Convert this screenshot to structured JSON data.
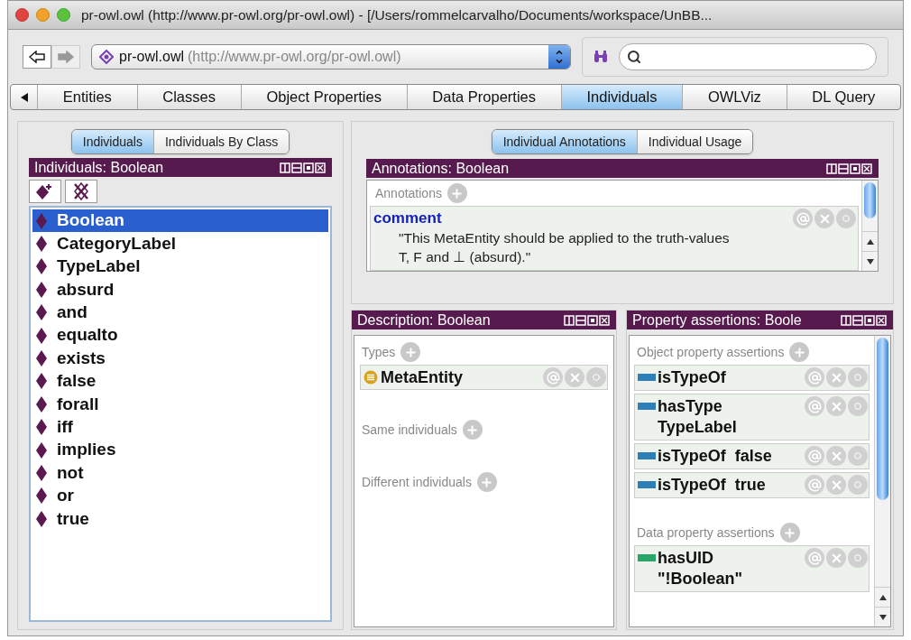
{
  "window": {
    "title": "pr-owl.owl (http://www.pr-owl.org/pr-owl.owl) - [/Users/rommelcarvalho/Documents/workspace/UnBB..."
  },
  "toolbar": {
    "back": {
      "disabled": false
    },
    "forward": {
      "disabled": true
    },
    "ontology": {
      "name": "pr-owl.owl",
      "iri": "(http://www.pr-owl.org/pr-owl.owl)"
    }
  },
  "tabs": [
    {
      "label": "Entities",
      "selected": false
    },
    {
      "label": "Classes",
      "selected": false
    },
    {
      "label": "Object Properties",
      "selected": false
    },
    {
      "label": "Data Properties",
      "selected": false
    },
    {
      "label": "Individuals",
      "selected": true
    },
    {
      "label": "OWLViz",
      "selected": false
    },
    {
      "label": "DL Query",
      "selected": false
    }
  ],
  "individuals_view": {
    "subtabs": [
      {
        "label": "Individuals",
        "selected": true
      },
      {
        "label": "Individuals By Class",
        "selected": false
      }
    ],
    "title": "Individuals: Boolean",
    "items": [
      {
        "label": "Boolean",
        "selected": true
      },
      {
        "label": "CategoryLabel",
        "selected": false
      },
      {
        "label": "TypeLabel",
        "selected": false
      },
      {
        "label": "absurd",
        "selected": false
      },
      {
        "label": "and",
        "selected": false
      },
      {
        "label": "equalto",
        "selected": false
      },
      {
        "label": "exists",
        "selected": false
      },
      {
        "label": "false",
        "selected": false
      },
      {
        "label": "forall",
        "selected": false
      },
      {
        "label": "iff",
        "selected": false
      },
      {
        "label": "implies",
        "selected": false
      },
      {
        "label": "not",
        "selected": false
      },
      {
        "label": "or",
        "selected": false
      },
      {
        "label": "true",
        "selected": false
      }
    ]
  },
  "annotations_view": {
    "subtabs": [
      {
        "label": "Individual Annotations",
        "selected": true
      },
      {
        "label": "Individual Usage",
        "selected": false
      }
    ],
    "title": "Annotations: Boolean",
    "section": "Annotations",
    "entries": [
      {
        "property": "comment",
        "value": "\"This MetaEntity should be applied to the truth-values T, F and ⊥ (absurd).\""
      }
    ]
  },
  "description": {
    "title": "Description: Boolean",
    "sections": [
      {
        "label": "Types",
        "items": [
          "MetaEntity"
        ]
      },
      {
        "label": "Same individuals"
      },
      {
        "label": "Different individuals"
      }
    ]
  },
  "property_assertions": {
    "title": "Property assertions: Boole",
    "sections": [
      {
        "label": "Object property assertions",
        "kind": "object",
        "items": [
          {
            "property": "isTypeOf"
          },
          {
            "property": "hasType",
            "value": "TypeLabel"
          },
          {
            "property": "isTypeOf",
            "value": "false"
          },
          {
            "property": "isTypeOf",
            "value": "true"
          }
        ]
      },
      {
        "label": "Data property assertions",
        "kind": "data",
        "items": [
          {
            "property": "hasUID",
            "value": "\"!Boolean\""
          }
        ]
      }
    ]
  }
}
